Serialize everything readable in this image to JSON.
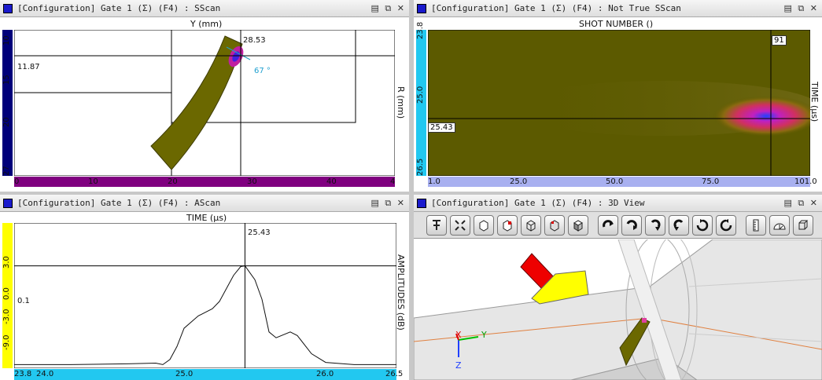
{
  "panels": {
    "sscan": {
      "title": "[Configuration] Gate 1 (Σ) (F4) : SScan",
      "top_axis_label": "Y (mm)",
      "right_axis_label": "R (mm)",
      "left_ticks": [
        "10",
        "15",
        "20",
        "27"
      ],
      "bottom_ticks": [
        "0",
        "10",
        "20",
        "30",
        "40",
        "4"
      ],
      "cursor_x_value": "28.53",
      "cursor_y_value": "11.87",
      "angle_label": "67 °"
    },
    "ntsscan": {
      "title": "[Configuration] Gate 1 (Σ) (F4) : Not True SScan",
      "top_axis_label": "SHOT NUMBER ()",
      "right_axis_label": "TIME (µs)",
      "left_ticks": [
        "23.8",
        "25.0",
        "26.5"
      ],
      "bottom_ticks": [
        "1.0",
        "25.0",
        "50.0",
        "75.0",
        "101.0"
      ],
      "cursor_x_value": "91",
      "cursor_y_value": "25.43"
    },
    "ascan": {
      "title": "[Configuration] Gate 1 (Σ) (F4) : AScan",
      "top_axis_label": "TIME (µs)",
      "right_axis_label": "AMPLITUDES (dB)",
      "left_ticks": [
        "3.0",
        "0.0",
        "-3.0",
        "-9.0"
      ],
      "bottom_ticks": [
        "23.8",
        "24.0",
        "25.0",
        "26.0",
        "26.5"
      ],
      "cursor_x_value": "25.43",
      "cursor_y_value": "0.1"
    },
    "view3d": {
      "title": "[Configuration] Gate 1 (Σ) (F4) : 3D View",
      "axis_x": "X",
      "axis_y": "Y",
      "axis_z": "Z",
      "toolbar_icons": [
        "pointer-icon",
        "fit-icon",
        "cube-solid-icon",
        "cube-red-icon",
        "cube-wire-icon",
        "cube-outline-icon",
        "cube-iso-icon",
        "rotate-cw-down-icon",
        "rotate-ccw-down-icon",
        "rotate-right-icon",
        "rotate-left-icon",
        "spin-cw-icon",
        "spin-ccw-icon",
        "ruler-icon",
        "protractor-icon",
        "box-icon"
      ]
    }
  },
  "window_controls": "▤ ⧉ ✕",
  "colors": {
    "olive_bg": "#5c5a00",
    "left_axis_blue": "#00007a",
    "bottom_axis_purple": "#800080",
    "cyan_axis": "#22c8f0",
    "yellow_axis": "#ffff00",
    "lavender_axis": "#a8b0f0"
  },
  "chart_data": [
    {
      "type": "line",
      "title": "",
      "xlabel": "TIME (µs)",
      "ylabel": "AMPLITUDES (dB)",
      "xlim": [
        23.8,
        26.5
      ],
      "x": [
        23.8,
        24.2,
        24.6,
        24.8,
        24.85,
        24.9,
        24.95,
        25.0,
        25.1,
        25.2,
        25.25,
        25.3,
        25.35,
        25.4,
        25.43,
        25.5,
        25.55,
        25.6,
        25.65,
        25.75,
        25.8,
        25.9,
        26.0,
        26.2,
        26.5
      ],
      "y": [
        -13.5,
        -13.5,
        -13.4,
        -13.3,
        -13.5,
        -12.8,
        -11.0,
        -8.5,
        -6.8,
        -5.8,
        -4.8,
        -3.0,
        -1.2,
        0.0,
        0.1,
        -1.8,
        -4.5,
        -9.0,
        -9.8,
        -9.0,
        -9.5,
        -12.0,
        -13.2,
        -13.5,
        -13.5
      ]
    }
  ]
}
